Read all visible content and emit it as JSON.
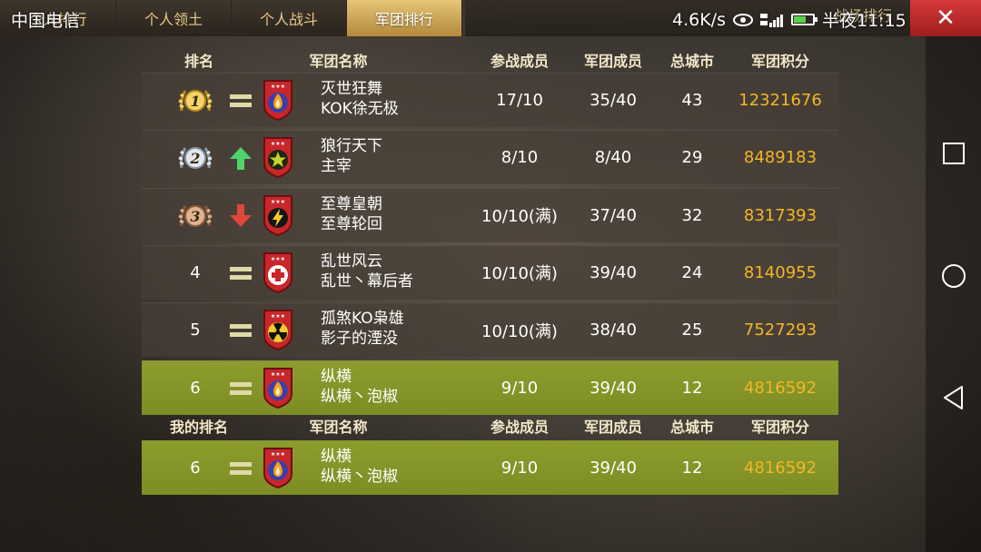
{
  "status_bar": {
    "carrier": "中国电信",
    "speed": "4.6K/s",
    "time": "半夜11:15"
  },
  "tabs": [
    {
      "label": "个人排行",
      "active": false
    },
    {
      "label": "个人领土",
      "active": false
    },
    {
      "label": "个人战斗",
      "active": false
    },
    {
      "label": "军团排行",
      "active": true
    }
  ],
  "rank_hint": "战场排行",
  "close_label": "✕",
  "table": {
    "headers": {
      "rank": "排名",
      "name": "军团名称",
      "battle_members": "参战成员",
      "members": "军团成员",
      "cities": "总城市",
      "score": "军团积分"
    },
    "rows": [
      {
        "rank": "1",
        "medal": "gold",
        "trend": "same",
        "emblem": "fire-emblem",
        "legion": "灭世狂舞",
        "leader": "KOK徐无极",
        "battle_members": "17/10",
        "members": "35/40",
        "cities": "43",
        "score": "12321676"
      },
      {
        "rank": "2",
        "medal": "silver",
        "trend": "up",
        "emblem": "star-emblem",
        "legion": "狼行天下",
        "leader": "主宰",
        "battle_members": "8/10",
        "members": "8/40",
        "cities": "29",
        "score": "8489183"
      },
      {
        "rank": "3",
        "medal": "bronze",
        "trend": "down",
        "emblem": "lightning-emblem",
        "legion": "至尊皇朝",
        "leader": "至尊轮回",
        "battle_members": "10/10(满)",
        "members": "37/40",
        "cities": "32",
        "score": "8317393"
      },
      {
        "rank": "4",
        "medal": "",
        "trend": "same",
        "emblem": "cross-emblem",
        "legion": "乱世风云",
        "leader": "乱世丶幕后者",
        "battle_members": "10/10(满)",
        "members": "39/40",
        "cities": "24",
        "score": "8140955"
      },
      {
        "rank": "5",
        "medal": "",
        "trend": "same",
        "emblem": "radiation-emblem",
        "legion": "孤煞KO枭雄",
        "leader": "影子的湮没",
        "battle_members": "10/10(满)",
        "members": "38/40",
        "cities": "25",
        "score": "7527293"
      },
      {
        "rank": "6",
        "medal": "",
        "trend": "same",
        "emblem": "fire-emblem",
        "legion": "纵横",
        "leader": "纵横丶泡椒",
        "battle_members": "9/10",
        "members": "39/40",
        "cities": "12",
        "score": "4816592",
        "highlight": true
      }
    ]
  },
  "my_rank": {
    "headers": {
      "rank": "我的排名",
      "name": "军团名称",
      "battle_members": "参战成员",
      "members": "军团成员",
      "cities": "总城市",
      "score": "军团积分"
    },
    "row": {
      "rank": "6",
      "trend": "same",
      "emblem": "fire-emblem",
      "legion": "纵横",
      "leader": "纵横丶泡椒",
      "battle_members": "9/10",
      "members": "39/40",
      "cities": "12",
      "score": "4816592"
    }
  },
  "colors": {
    "score": "#f3b625",
    "highlight_row": "#7d8d25",
    "tab_active": "#d4ab5a",
    "close_button": "#c12b2b",
    "trend_up": "#4fd36a",
    "trend_down": "#e0473a"
  }
}
